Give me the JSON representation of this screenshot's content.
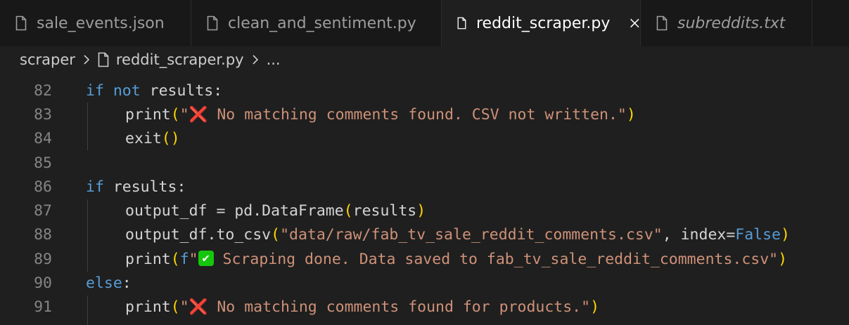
{
  "tabs": [
    {
      "label": "sale_events.json",
      "active": false,
      "italic": false
    },
    {
      "label": "clean_and_sentiment.py",
      "active": false,
      "italic": false
    },
    {
      "label": "reddit_scraper.py",
      "active": true,
      "italic": false
    },
    {
      "label": "subreddits.txt",
      "active": false,
      "italic": true
    }
  ],
  "breadcrumb": {
    "folder": "scraper",
    "file": "reddit_scraper.py",
    "ellipsis": "..."
  },
  "editor": {
    "line_numbers": [
      "82",
      "83",
      "84",
      "85",
      "86",
      "87",
      "88",
      "89",
      "90",
      "91"
    ],
    "lines": {
      "l82": {
        "kw1": "if",
        "kw2": "not",
        "rest": " results:"
      },
      "l83": {
        "fn": "print",
        "open": "(",
        "q": "\"",
        "emoji": "❌",
        "text": " No matching comments found. CSV not written.\"",
        "close": ")"
      },
      "l84": {
        "fn": "exit",
        "parens": "()"
      },
      "l86": {
        "kw": "if",
        "rest": " results:"
      },
      "l87": {
        "lhs": "output_df = pd.DataFrame",
        "open": "(",
        "arg": "results",
        "close": ")"
      },
      "l88": {
        "lhs": "output_df.to_csv",
        "open": "(",
        "str": "\"data/raw/fab_tv_sale_reddit_comments.csv\"",
        "mid": ", index=",
        "val": "False",
        "close": ")"
      },
      "l89": {
        "fn": "print",
        "open": "(",
        "prefix": "f",
        "q": "\"",
        "emoji": "✔",
        "text": " Scraping done. Data saved to fab_tv_sale_reddit_comments.csv\"",
        "close": ")"
      },
      "l90": {
        "kw": "else",
        "rest": ":"
      },
      "l91": {
        "fn": "print",
        "open": "(",
        "q": "\"",
        "emoji": "❌",
        "text": " No matching comments found for products.\"",
        "close": ")"
      }
    }
  },
  "colors": {
    "keyword": "#569cd6",
    "string": "#ce9178",
    "bracket": "#ffd700",
    "background": "#1f1f1f"
  }
}
